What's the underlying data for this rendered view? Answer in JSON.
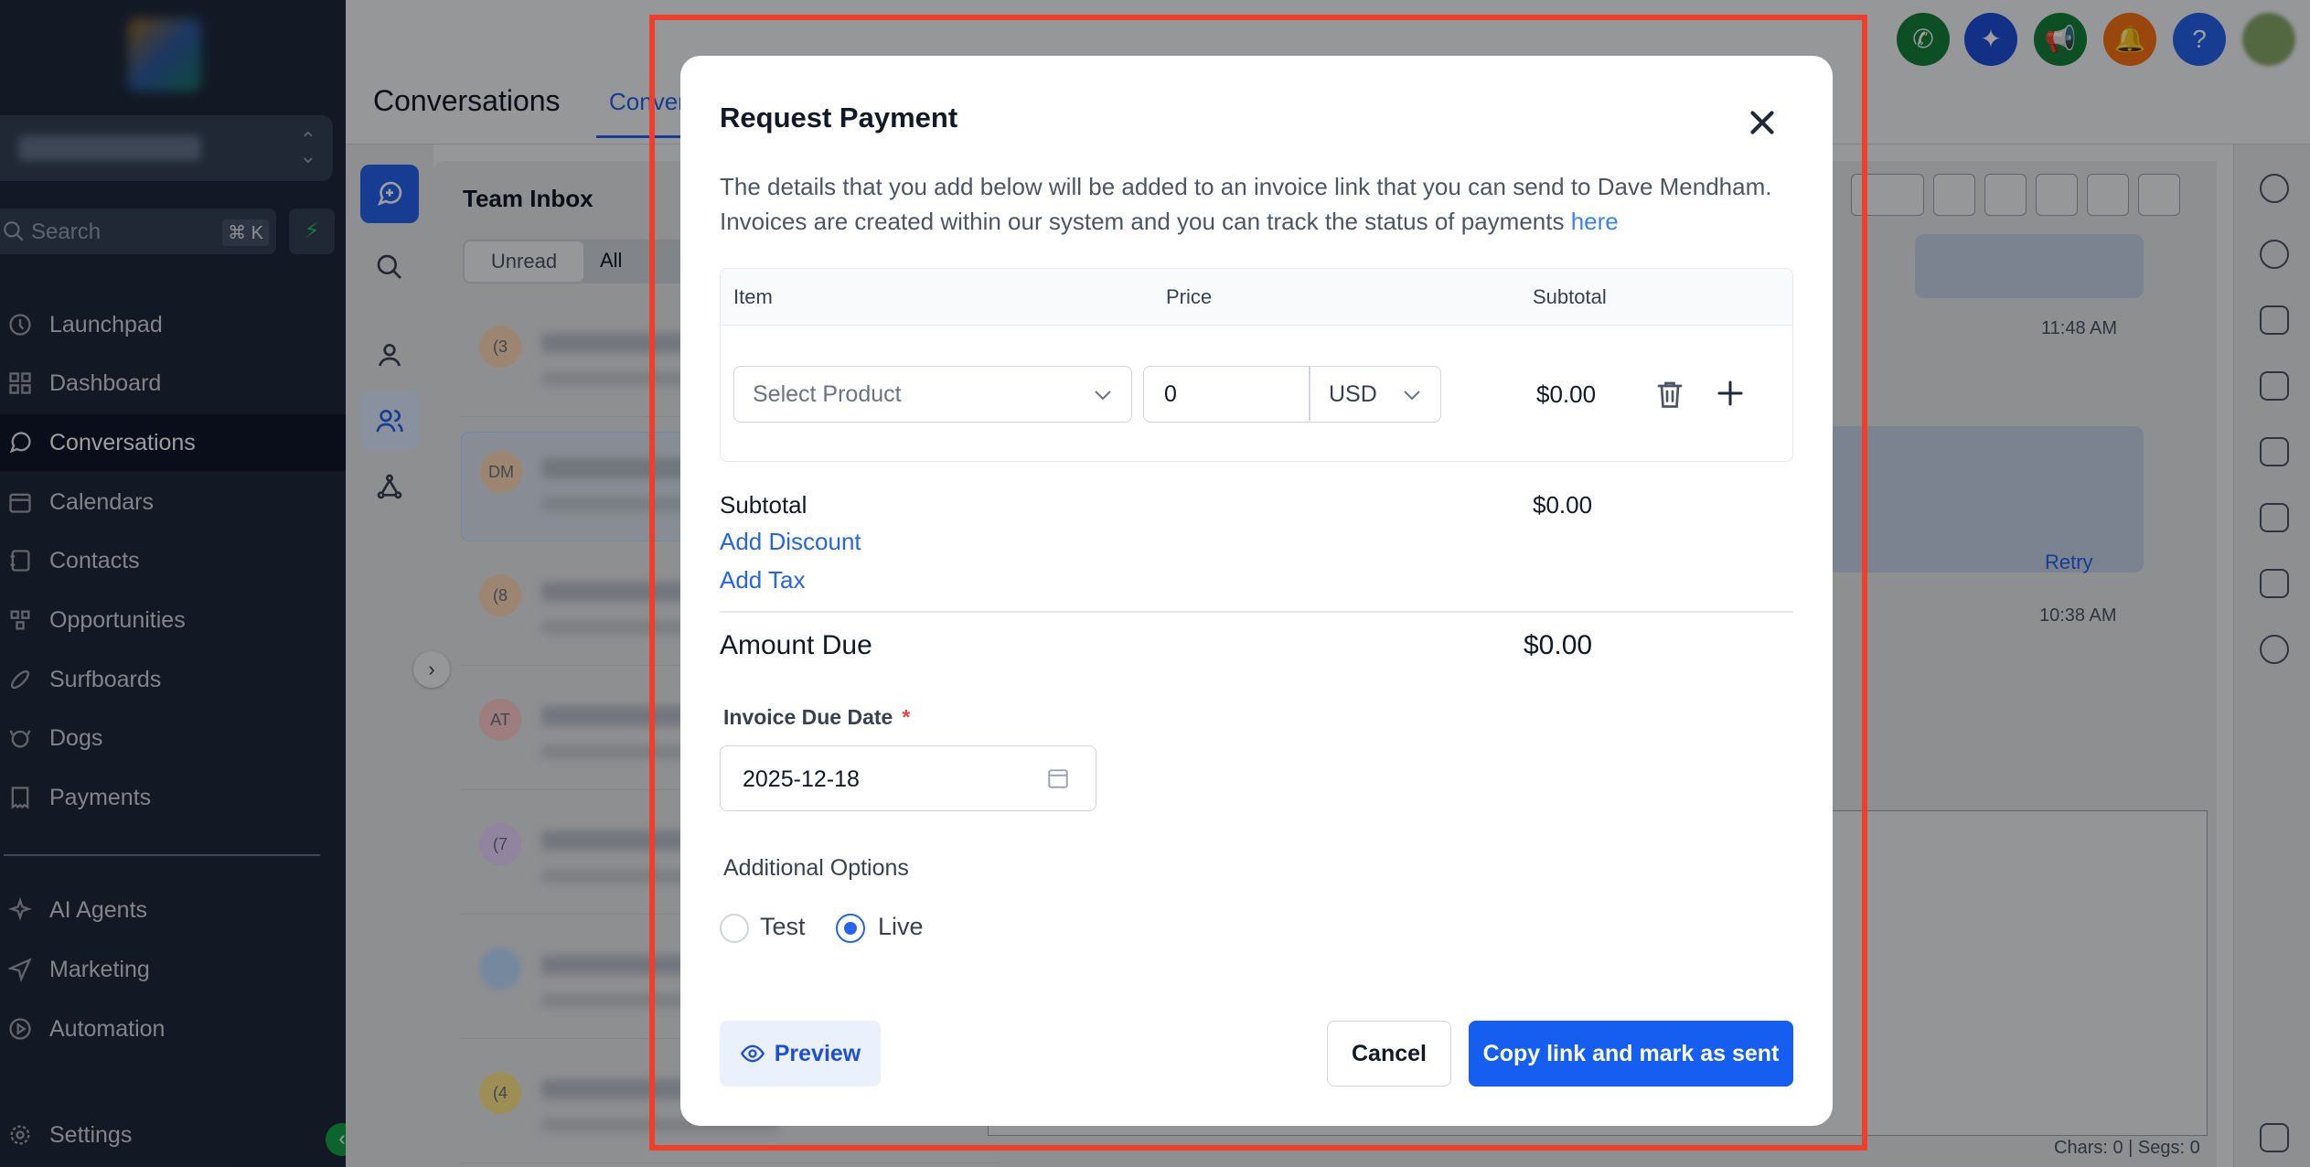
{
  "sidebar": {
    "search_placeholder": "Search",
    "search_shortcut": "⌘ K",
    "items": [
      {
        "label": "Launchpad",
        "icon": "rocket-icon"
      },
      {
        "label": "Dashboard",
        "icon": "grid-icon"
      },
      {
        "label": "Conversations",
        "icon": "chat-icon",
        "active": true
      },
      {
        "label": "Calendars",
        "icon": "calendar-icon"
      },
      {
        "label": "Contacts",
        "icon": "contacts-icon"
      },
      {
        "label": "Opportunities",
        "icon": "opportunities-icon"
      },
      {
        "label": "Surfboards",
        "icon": "surfboard-icon"
      },
      {
        "label": "Dogs",
        "icon": "dog-icon"
      },
      {
        "label": "Payments",
        "icon": "receipt-icon"
      },
      {
        "label": "AI Agents",
        "icon": "sparkle-icon"
      },
      {
        "label": "Marketing",
        "icon": "send-icon"
      },
      {
        "label": "Automation",
        "icon": "play-circle-icon"
      },
      {
        "label": "Settings",
        "icon": "gear-icon"
      }
    ]
  },
  "header": {
    "page_title": "Conversations",
    "active_tab": "Conver"
  },
  "inbox": {
    "title": "Team Inbox",
    "filters": [
      "Unread",
      "All"
    ],
    "avatars": [
      "(3",
      "DM",
      "(8",
      "AT",
      "(7",
      "",
      "(4"
    ]
  },
  "chat": {
    "time1": "11:48 AM",
    "time2": "10:38 AM",
    "retry": "Retry",
    "char_count": "Chars: 0 | Segs: 0"
  },
  "modal": {
    "title": "Request Payment",
    "description": "The details that you add below will be added to an invoice link that you can send to Dave Mendham. Invoices are created within our system and you can track the status of payments",
    "description_link": "here",
    "table": {
      "headers": [
        "Item",
        "Price",
        "Subtotal"
      ],
      "product_placeholder": "Select Product",
      "price": "0",
      "currency": "USD",
      "row_subtotal": "$0.00"
    },
    "subtotal_label": "Subtotal",
    "subtotal_value": "$0.00",
    "add_discount": "Add Discount",
    "add_tax": "Add Tax",
    "amount_due_label": "Amount Due",
    "amount_due_value": "$0.00",
    "due_date_label": "Invoice Due Date",
    "due_date_required": "*",
    "due_date_value": "2025-12-18",
    "additional_options_label": "Additional Options",
    "options": [
      {
        "label": "Test",
        "checked": false
      },
      {
        "label": "Live",
        "checked": true
      }
    ],
    "preview_button": "Preview",
    "cancel_button": "Cancel",
    "copy_button": "Copy link and mark as sent"
  },
  "colors": {
    "primary": "#155eef",
    "link": "#2563eb",
    "highlight_border": "#ef3e2b",
    "sidebar_bg": "#1e293b"
  }
}
